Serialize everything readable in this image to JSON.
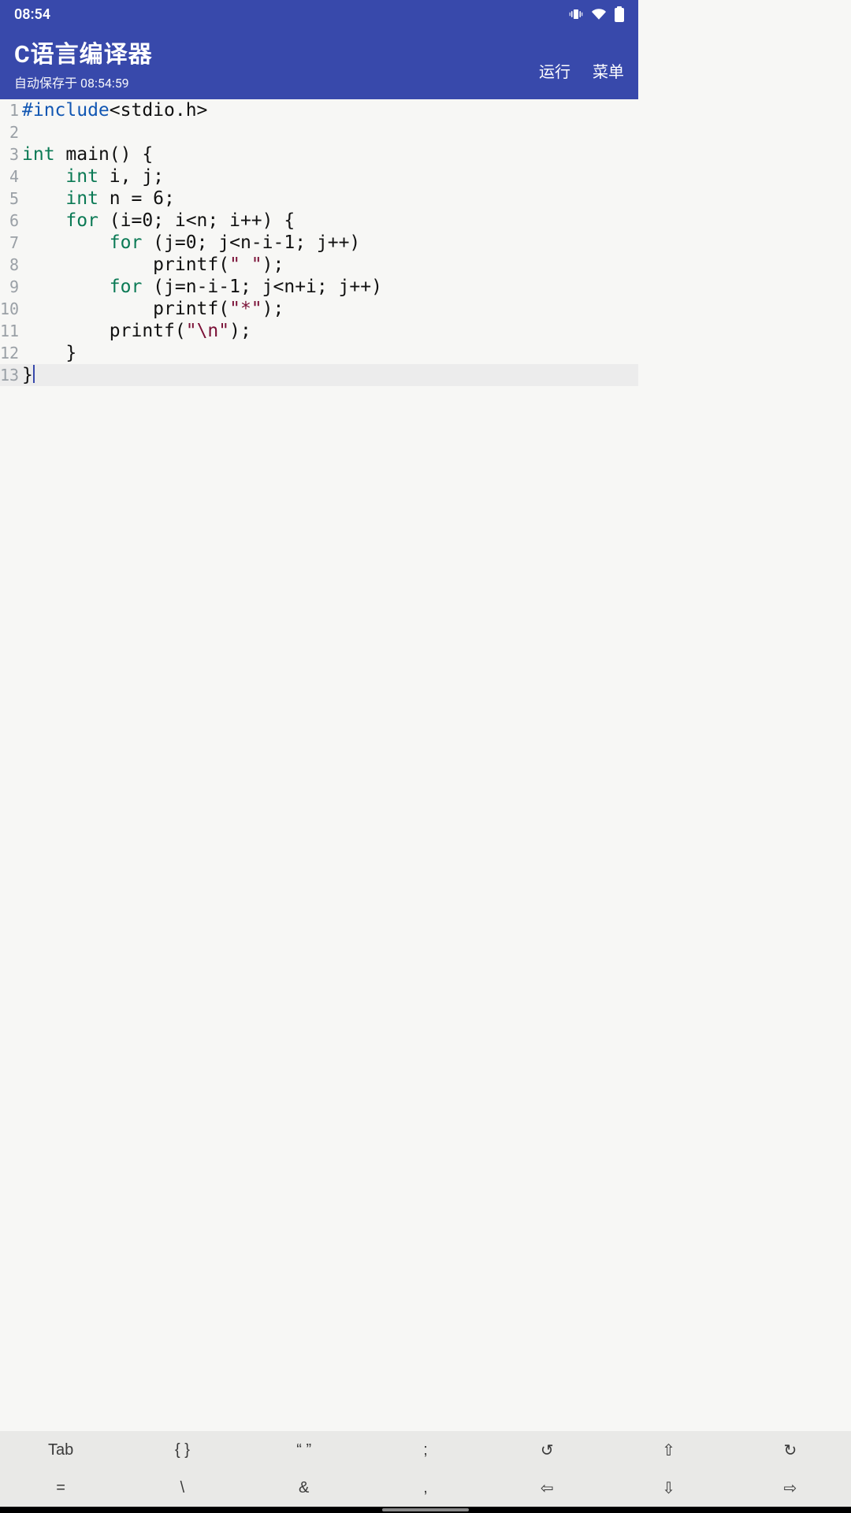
{
  "status": {
    "time": "08:54",
    "icons": [
      "vibrate",
      "wifi",
      "battery"
    ]
  },
  "header": {
    "title": "C语言编译器",
    "subtitle": "自动保存于 08:54:59",
    "actions": {
      "run": "运行",
      "menu": "菜单"
    }
  },
  "editor": {
    "current_line": 13,
    "lines": [
      {
        "n": 1,
        "tokens": [
          [
            "pp",
            "#include"
          ],
          [
            "punc",
            "<stdio.h>"
          ]
        ]
      },
      {
        "n": 2,
        "tokens": []
      },
      {
        "n": 3,
        "tokens": [
          [
            "kw",
            "int"
          ],
          [
            "op",
            " "
          ],
          [
            "fn",
            "main"
          ],
          [
            "punc",
            "() {"
          ]
        ]
      },
      {
        "n": 4,
        "tokens": [
          [
            "op",
            "    "
          ],
          [
            "kw",
            "int"
          ],
          [
            "op",
            " i, j;"
          ]
        ]
      },
      {
        "n": 5,
        "tokens": [
          [
            "op",
            "    "
          ],
          [
            "kw",
            "int"
          ],
          [
            "op",
            " n = 6;"
          ]
        ]
      },
      {
        "n": 6,
        "tokens": [
          [
            "op",
            "    "
          ],
          [
            "kw",
            "for"
          ],
          [
            "op",
            " (i=0; i<n; i++) {"
          ]
        ]
      },
      {
        "n": 7,
        "tokens": [
          [
            "op",
            "        "
          ],
          [
            "kw",
            "for"
          ],
          [
            "op",
            " (j=0; j<n-i-1; j++)"
          ]
        ]
      },
      {
        "n": 8,
        "tokens": [
          [
            "op",
            "            printf("
          ],
          [
            "str",
            "\" \""
          ],
          [
            "op",
            ");"
          ]
        ]
      },
      {
        "n": 9,
        "tokens": [
          [
            "op",
            "        "
          ],
          [
            "kw",
            "for"
          ],
          [
            "op",
            " (j=n-i-1; j<n+i; j++)"
          ]
        ]
      },
      {
        "n": 10,
        "tokens": [
          [
            "op",
            "            printf("
          ],
          [
            "str",
            "\"*\""
          ],
          [
            "op",
            ");"
          ]
        ]
      },
      {
        "n": 11,
        "tokens": [
          [
            "op",
            "        printf("
          ],
          [
            "str",
            "\"\\n\""
          ],
          [
            "op",
            ");"
          ]
        ]
      },
      {
        "n": 12,
        "tokens": [
          [
            "op",
            "    }"
          ]
        ]
      },
      {
        "n": 13,
        "tokens": [
          [
            "op",
            "}"
          ]
        ]
      }
    ]
  },
  "toolbar": {
    "row1": [
      "Tab",
      "{ }",
      "“ ”",
      ";",
      "↺",
      "⇧",
      "↻"
    ],
    "row2": [
      "=",
      "\\",
      "&",
      ",",
      "⇦",
      "⇩",
      "⇨"
    ]
  }
}
